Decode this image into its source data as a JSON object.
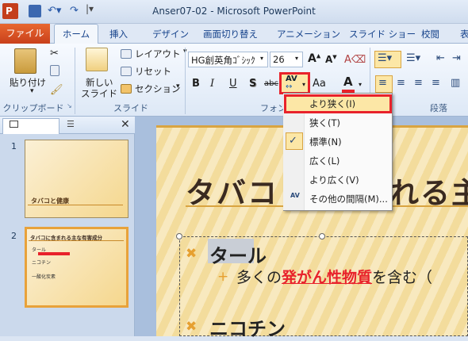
{
  "window": {
    "title": "Anser07-02 - Microsoft PowerPoint"
  },
  "tabs": [
    {
      "label": "ファイル"
    },
    {
      "label": "ホーム"
    },
    {
      "label": "挿入"
    },
    {
      "label": "デザイン"
    },
    {
      "label": "画面切り替え"
    },
    {
      "label": "アニメーション"
    },
    {
      "label": "スライド ショー"
    },
    {
      "label": "校閲"
    },
    {
      "label": "表"
    }
  ],
  "ribbon": {
    "clipboard": {
      "paste_label": "貼り付け",
      "group_label": "クリップボード"
    },
    "slides": {
      "new_slide_label_1": "新しい",
      "new_slide_label_2": "スライド",
      "layout_label": "レイアウト",
      "reset_label": "リセット",
      "section_label": "セクション",
      "group_label": "スライド"
    },
    "font": {
      "font_name": "HG創英角ｺﾞｼｯｸ",
      "font_size": "26",
      "bold": "B",
      "italic": "I",
      "underline": "U",
      "shadow": "S",
      "strike": "abc",
      "spacing": "AV",
      "case": "Aa",
      "color": "A",
      "group_label": "フォント"
    },
    "paragraph": {
      "group_label": "段落"
    }
  },
  "spacing_menu": {
    "items": [
      {
        "label": "より狭く(I)",
        "checked": false,
        "highlighted": true
      },
      {
        "label": "狭く(T)",
        "checked": false,
        "highlighted": false
      },
      {
        "label": "標準(N)",
        "checked": true,
        "highlighted": false
      },
      {
        "label": "広く(L)",
        "checked": false,
        "highlighted": false
      },
      {
        "label": "より広く(V)",
        "checked": false,
        "highlighted": false
      },
      {
        "label": "その他の間隔(M)...",
        "checked": false,
        "highlighted": false
      }
    ]
  },
  "thumbnails": [
    {
      "number": "1",
      "title": "タバコと健康"
    },
    {
      "number": "2",
      "title": "タバコに含まれる主な有害成分",
      "lines": [
        "タール",
        "ニコチン",
        "一酸化炭素"
      ]
    }
  ],
  "slide": {
    "title_left": "タバコ",
    "title_right": "れる主",
    "bullets": [
      {
        "text": "タール",
        "sub_prefix": "多くの",
        "sub_highlight": "発がん性物質",
        "sub_suffix": "を含む（"
      },
      {
        "text": "ニコチン"
      }
    ]
  },
  "colors": {
    "accent_red": "#e8222b",
    "file_tab": "#d0471f",
    "bullet_orange": "#e6a030"
  }
}
